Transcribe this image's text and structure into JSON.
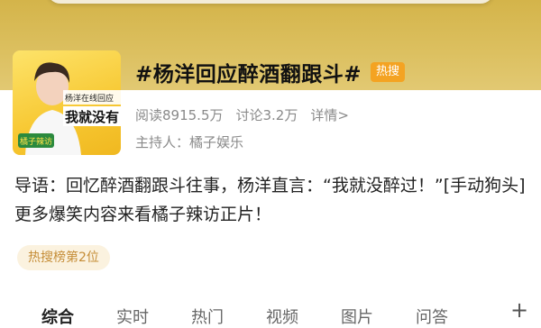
{
  "topic": {
    "title": "#杨洋回应醉酒翻跟斗#",
    "hot_badge": "热搜",
    "reads": "阅读8915.5万",
    "discussions": "讨论3.2万",
    "details": "详情>",
    "host": "主持人：橘子娱乐",
    "thumbnail": {
      "banner_line1": "杨洋在线回应",
      "banner_line2": "我就没有",
      "logo": "橘子辣访"
    }
  },
  "description": "导语：回忆醉酒翻跟斗往事，杨洋直言：“我就没醉过！”[手动狗头]更多爆笑内容来看橘子辣访正片！",
  "rank": "热搜榜第2位",
  "tabs": [
    {
      "label": "综合",
      "active": true
    },
    {
      "label": "实时",
      "active": false
    },
    {
      "label": "热门",
      "active": false
    },
    {
      "label": "视频",
      "active": false
    },
    {
      "label": "图片",
      "active": false
    },
    {
      "label": "问答",
      "active": false
    }
  ],
  "plus_label": "+",
  "colors": {
    "hero": "#dcc060",
    "hot_badge": "#f4a322",
    "rank_text": "#c58d37",
    "rank_bg": "#fbf2df"
  }
}
